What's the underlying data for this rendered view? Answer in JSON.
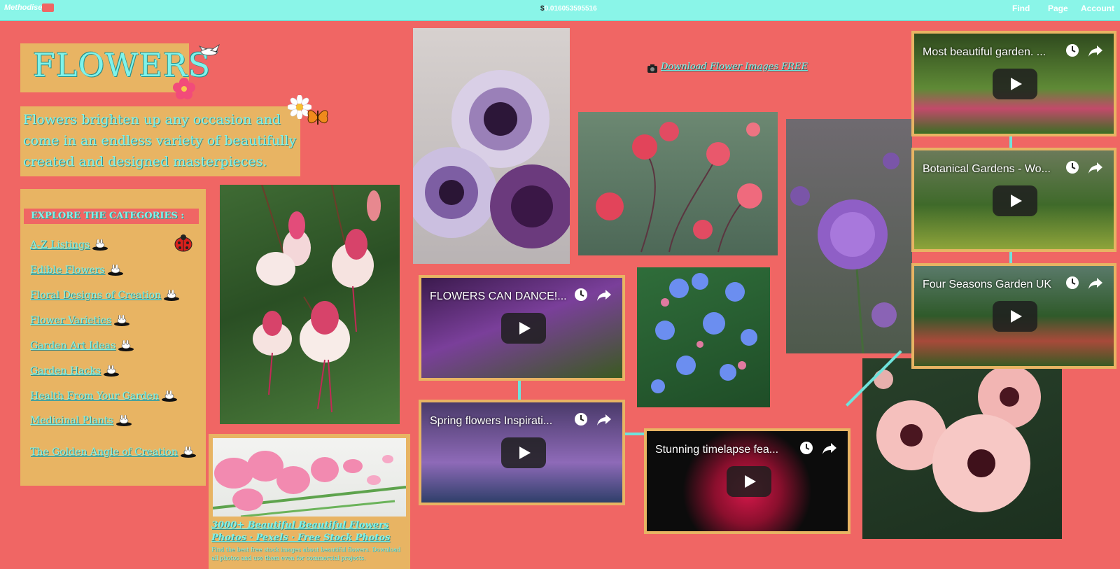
{
  "topbar": {
    "brand": "Methodise",
    "brand_suffix": "",
    "price_symbol": "$",
    "price_value": "0.016053595516",
    "nav": [
      "Find",
      "Page",
      "Account"
    ]
  },
  "hero": {
    "title": "FLOWERS",
    "intro": "Flowers brighten up any occasion and come in an endless variety of beautifully created and designed masterpieces."
  },
  "categories": {
    "header": "EXPLORE THE CATEGORIES :",
    "items": [
      "A-Z Listings",
      "Edible Flowers",
      "Floral Designs of Creation",
      "Flower Varieties",
      "Garden Art Ideas",
      "Garden Hacks",
      "Health From Your Garden",
      "Medicinal Plants",
      "The Golden Angle of Creation"
    ]
  },
  "download_link": "Download Flower Images FREE",
  "stock_caption": {
    "title": "3000+ Beautiful Beautiful Flowers Photos · Pexels · Free Stock Photos",
    "description": "Find the best free stock images about beautiful flowers. Download all photos and use them even for commercial projects."
  },
  "videos": [
    {
      "title": "FLOWERS CAN DANCE!..."
    },
    {
      "title": "Spring flowers Inspirati..."
    },
    {
      "title": "Stunning timelapse fea..."
    },
    {
      "title": "Most beautiful garden. ..."
    },
    {
      "title": "Botanical Gardens - Wo..."
    },
    {
      "title": "Four Seasons Garden UK"
    }
  ]
}
